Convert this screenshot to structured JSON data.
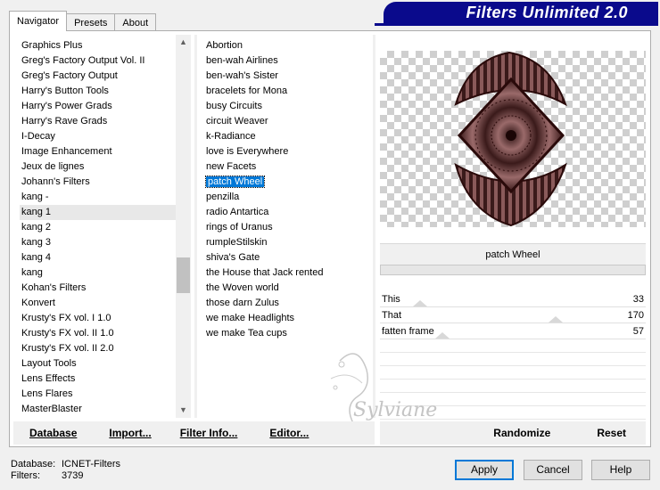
{
  "window": {
    "title": "Filters Unlimited 2.0",
    "brand_color": "#0a0a8c"
  },
  "tabs": [
    {
      "label": "Navigator",
      "active": true
    },
    {
      "label": "Presets",
      "active": false
    },
    {
      "label": "About",
      "active": false
    }
  ],
  "categories": [
    "Graphics Plus",
    "Greg's Factory Output Vol. II",
    "Greg's Factory Output",
    "Harry's Button Tools",
    "Harry's Power Grads",
    "Harry's Rave Grads",
    "I-Decay",
    "Image Enhancement",
    "Jeux de lignes",
    "Johann's Filters",
    "kang -",
    "kang 1",
    "kang 2",
    "kang 3",
    "kang 4",
    "kang",
    "Kohan's Filters",
    "Konvert",
    "Krusty's FX vol. I 1.0",
    "Krusty's FX vol. II 1.0",
    "Krusty's FX vol. II 2.0",
    "Layout Tools",
    "Lens Effects",
    "Lens Flares",
    "MasterBlaster"
  ],
  "current_category": "kang 1",
  "filters": [
    "Abortion",
    "ben-wah Airlines",
    "ben-wah's Sister",
    "bracelets for Mona",
    "busy Circuits",
    "circuit Weaver",
    "k-Radiance",
    "love is Everywhere",
    "new Facets",
    "patch Wheel",
    "penzilla",
    "radio Antartica",
    "rings of Uranus",
    "rumpleStilskin",
    "shiva's Gate",
    "the House that Jack rented",
    "the Woven world",
    "those darn Zulus",
    "we make Headlights",
    "we make Tea cups"
  ],
  "selected_filter": "patch Wheel",
  "filter_title": "patch Wheel",
  "sliders": [
    {
      "name": "This",
      "value": "33",
      "fraction": 0.13
    },
    {
      "name": "That",
      "value": "170",
      "fraction": 0.67
    },
    {
      "name": "fatten frame",
      "value": "57",
      "fraction": 0.22
    }
  ],
  "buttons": {
    "database": "Database",
    "import": "Import...",
    "filter_info": "Filter Info...",
    "editor": "Editor...",
    "randomize": "Randomize",
    "reset": "Reset",
    "apply": "Apply",
    "cancel": "Cancel",
    "help": "Help"
  },
  "status": {
    "database_label": "Database:",
    "database_value": "ICNET-Filters",
    "filters_label": "Filters:",
    "filters_value": "3739"
  },
  "watermark": "Sylviane",
  "colors": {
    "selection": "#0078d7",
    "preview_dark": "#3a1a1a",
    "preview_mauve": "#8a5a5a"
  }
}
